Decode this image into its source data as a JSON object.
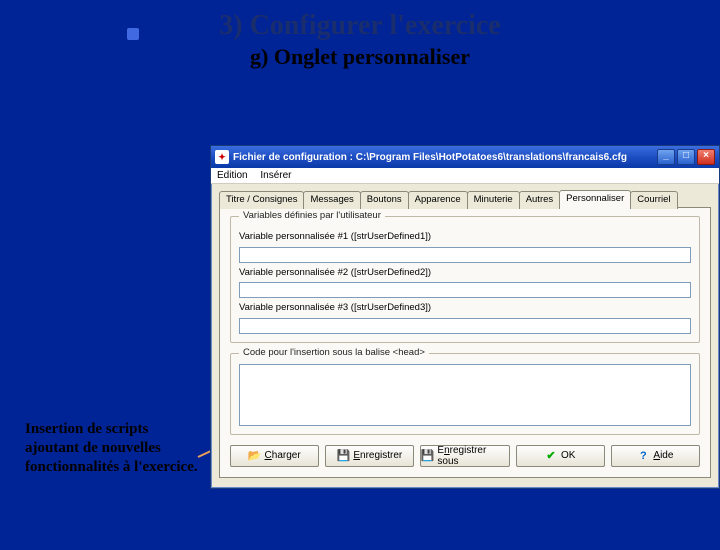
{
  "slide": {
    "title": "3) Configurer l'exercice",
    "subtitle": "g) Onglet personnaliser"
  },
  "caption": "Insertion de scripts ajoutant de nouvelles fonctionnalités à l'exercice.",
  "window": {
    "title": "Fichier de configuration : C:\\Program Files\\HotPotatoes6\\translations\\francais6.cfg",
    "menu": {
      "edition": "Edition",
      "inserer": "Insérer"
    },
    "win_buttons": {
      "min": "_",
      "max": "□",
      "close": "×"
    }
  },
  "tabs": [
    "Titre / Consignes",
    "Messages",
    "Boutons",
    "Apparence",
    "Minuterie",
    "Autres",
    "Personnaliser",
    "Courriel"
  ],
  "active_tab": "Personnaliser",
  "group_user_vars": {
    "legend": "Variables définies par l'utilisateur",
    "fields": [
      {
        "label": "Variable personnalisée #1 ([strUserDefined1])",
        "value": ""
      },
      {
        "label": "Variable personnalisée #2 ([strUserDefined2])",
        "value": ""
      },
      {
        "label": "Variable personnalisée #3 ([strUserDefined3])",
        "value": ""
      }
    ]
  },
  "group_head": {
    "legend": "Code pour l'insertion sous la balise <head>",
    "value": ""
  },
  "buttons": {
    "load": "Charger",
    "save": "Enregistrer",
    "saveas": "Enregistrer sous",
    "ok": "OK",
    "help": "Aide"
  }
}
